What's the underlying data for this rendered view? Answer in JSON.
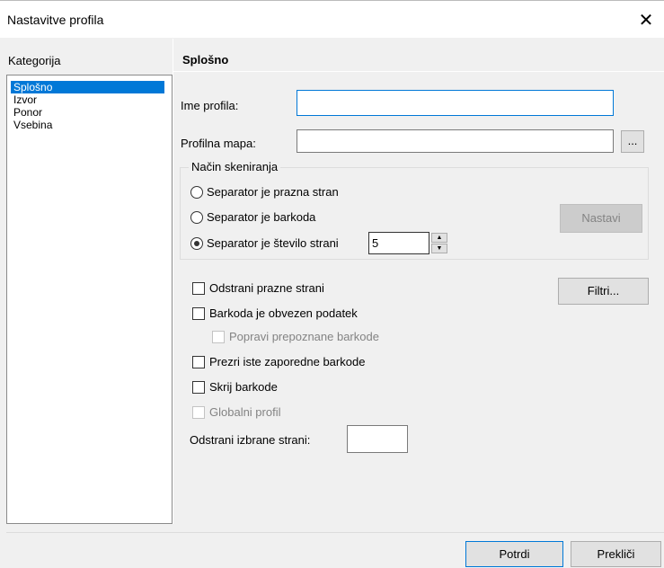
{
  "window": {
    "title": "Nastavitve profila",
    "close_glyph": "✕"
  },
  "sidebar": {
    "label": "Kategorija",
    "items": [
      {
        "label": "Splošno",
        "selected": true
      },
      {
        "label": "Izvor"
      },
      {
        "label": "Ponor"
      },
      {
        "label": "Vsebina"
      }
    ]
  },
  "panel": {
    "heading": "Splošno",
    "profile_name_label": "Ime profila:",
    "profile_name_value": "",
    "profile_folder_label": "Profilna mapa:",
    "profile_folder_value": "",
    "browse_label": "...",
    "scan_group": {
      "title": "Način skeniranja",
      "options": [
        {
          "label": "Separator je prazna stran",
          "checked": false
        },
        {
          "label": "Separator je barkoda",
          "checked": false
        },
        {
          "label": "Separator je število strani",
          "checked": true
        }
      ],
      "pages_value": "5",
      "set_button": "Nastavi"
    },
    "checkboxes": {
      "remove_blank": "Odstrani prazne strani",
      "barcode_required": "Barkoda je obvezen podatek",
      "fix_barcodes": "Popravi prepoznane barkode",
      "ignore_same": "Prezri iste zaporedne barkode",
      "hide_barcodes": "Skrij barkode",
      "global_profile": "Globalni profil"
    },
    "filters_button": "Filtri...",
    "remove_selected_label": "Odstrani izbrane strani:",
    "remove_selected_value": ""
  },
  "footer": {
    "ok": "Potrdi",
    "cancel": "Prekliči"
  }
}
